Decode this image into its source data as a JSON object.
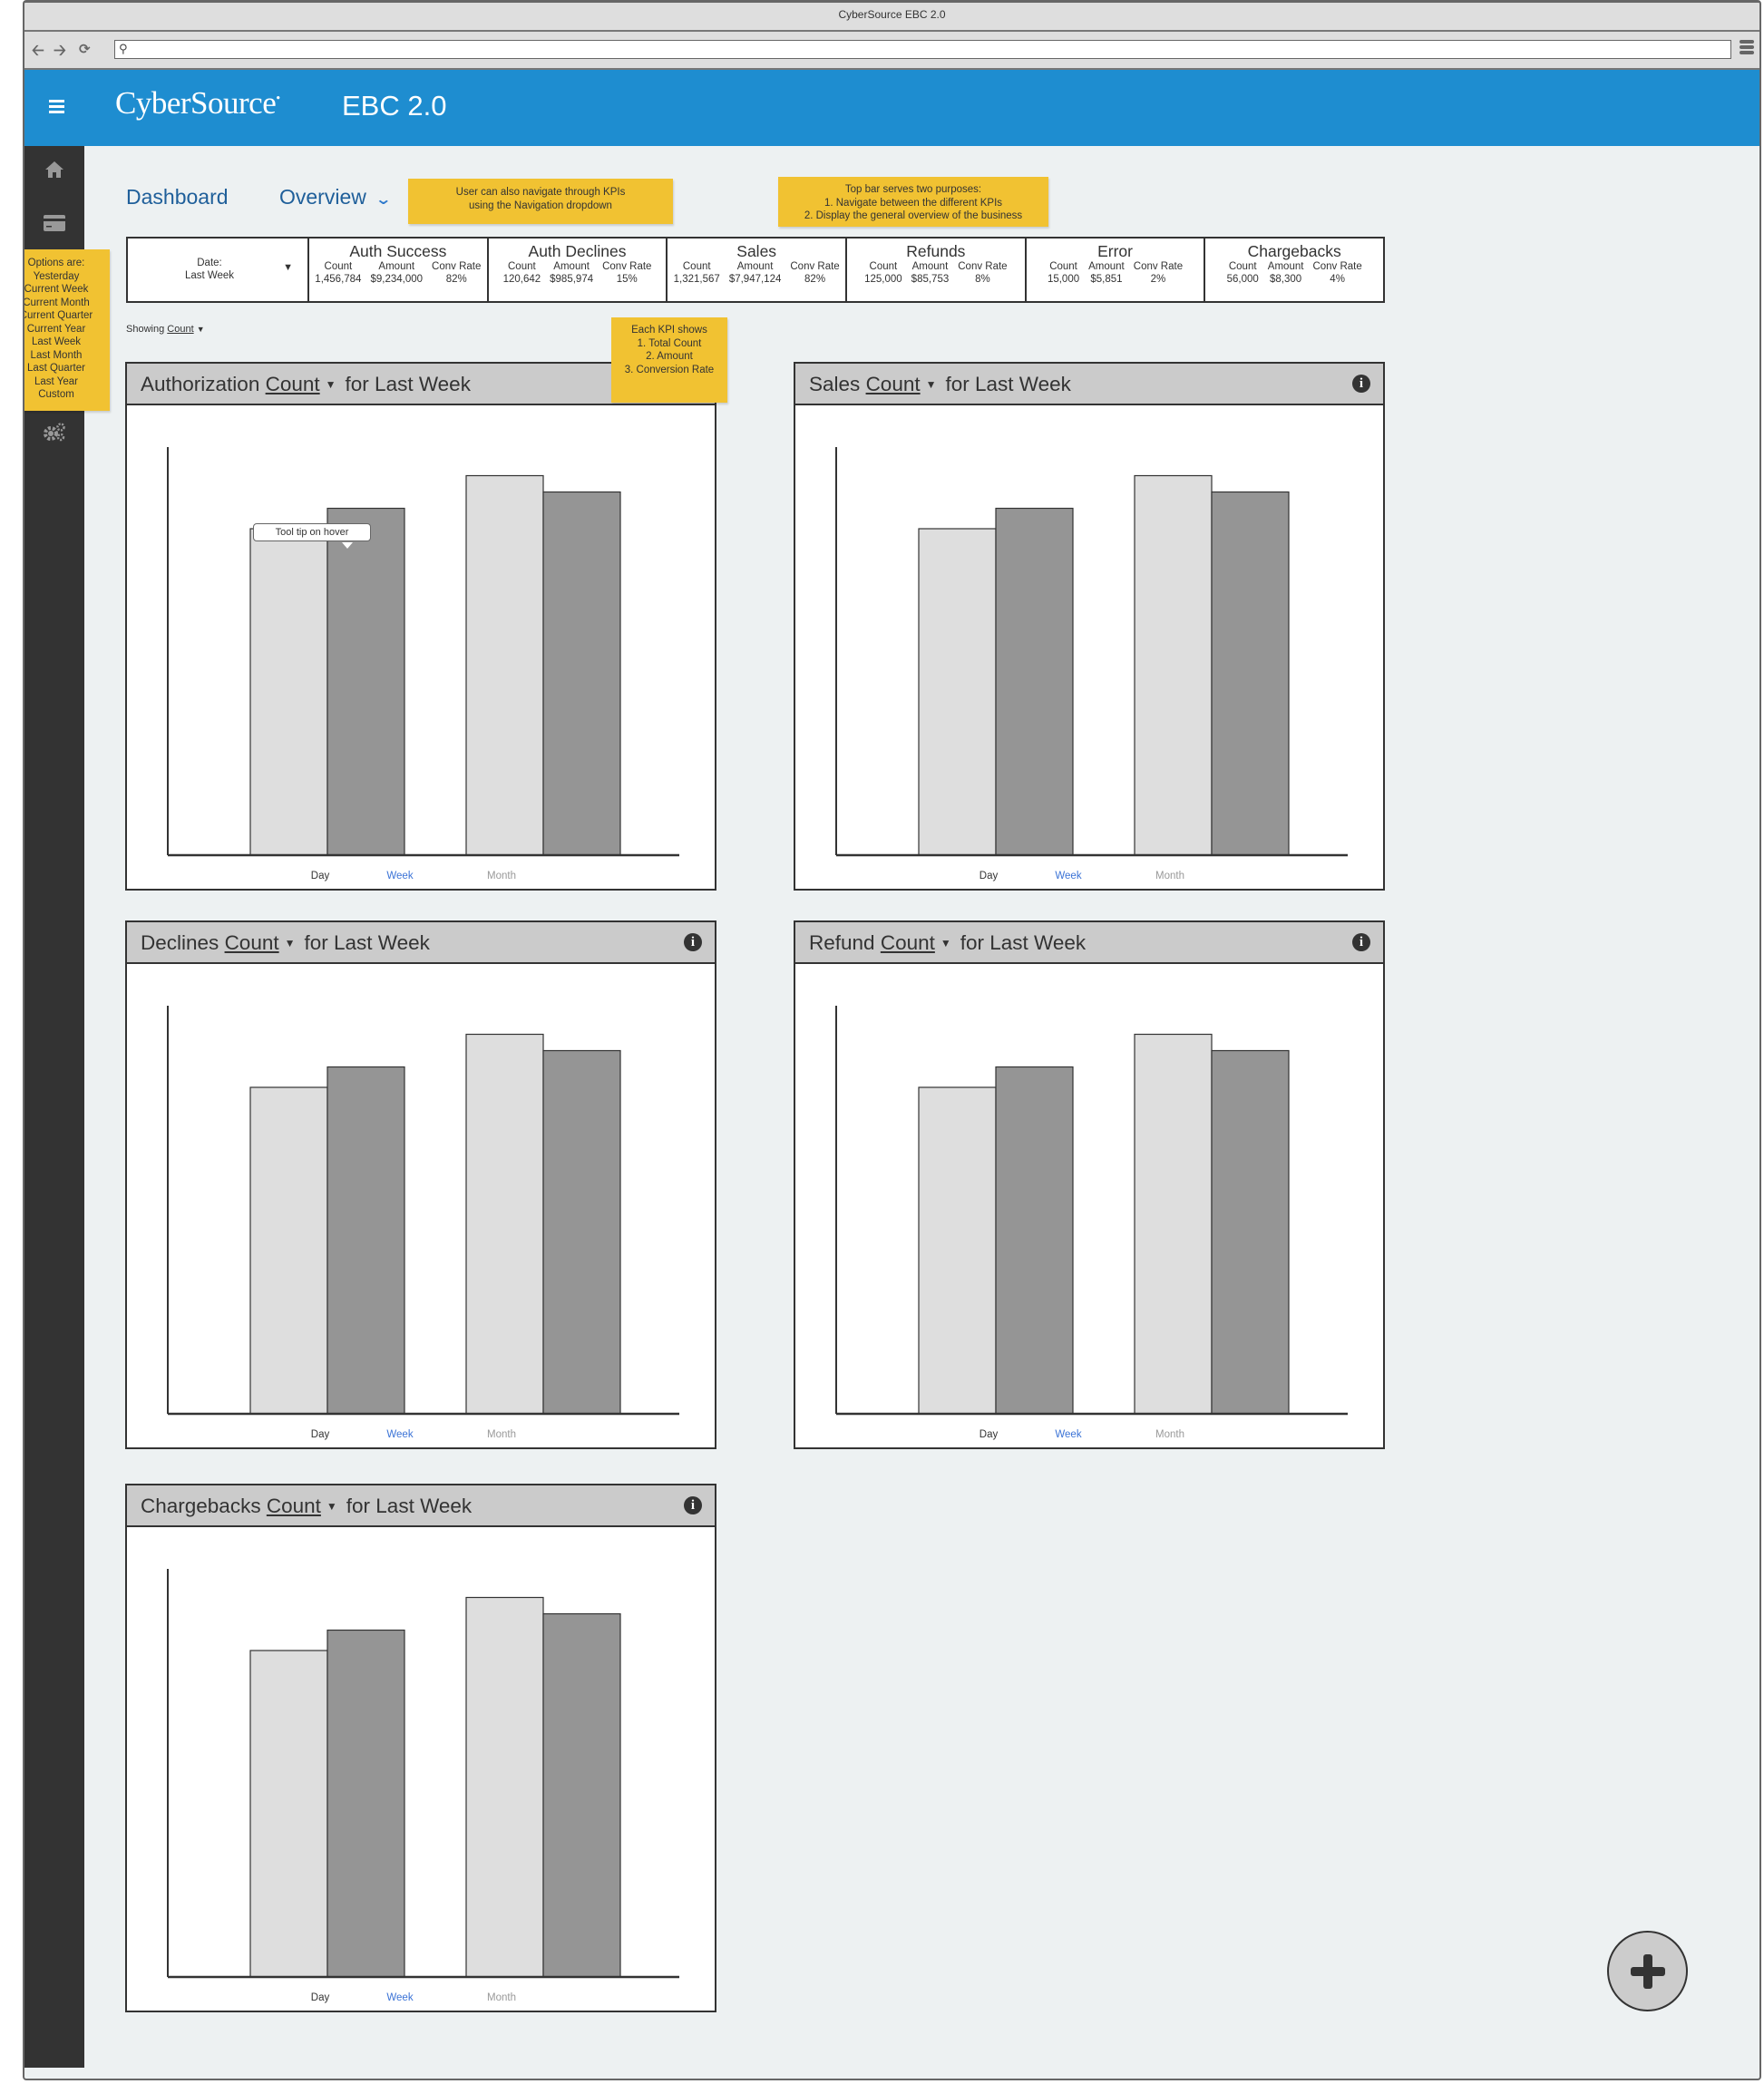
{
  "browser": {
    "window_title": "CyberSource EBC 2.0",
    "url_value": "",
    "icons": [
      "back-arrow-icon",
      "forward-arrow-icon",
      "reload-icon",
      "search-icon",
      "browser-menu-icon"
    ]
  },
  "header": {
    "brand": "CyberSource",
    "brand_mark": "•",
    "app_name": "EBC 2.0",
    "menu_icon": "hamburger-icon",
    "accent_color": "#1e8dd0"
  },
  "sidebar": {
    "items": [
      {
        "name": "home",
        "icon": "home-icon"
      },
      {
        "name": "payments",
        "icon": "credit-card-icon"
      },
      {
        "name": "settings",
        "icon": "gears-icon"
      }
    ]
  },
  "breadcrumb": {
    "dashboard": "Dashboard",
    "overview": "Overview"
  },
  "annotations": {
    "nav_dropdown": "User can also navigate through KPIs using the Navigation dropdown",
    "top_bar_title": "Top bar serves two purposes:",
    "top_bar_1": "1. Navigate between the different KPIs",
    "top_bar_2": "2. Display the general overview of the business",
    "kpi_shows_title": "Each KPI shows",
    "kpi_shows_1": "1. Total Count",
    "kpi_shows_2": "2. Amount",
    "kpi_shows_3": "3. Conversion Rate",
    "options_title": "Options are:",
    "options": [
      "Yesterday",
      "Current Week",
      "Current Month",
      "Current Quarter",
      "Current Year",
      "Last Week",
      "Last Month",
      "Last Quarter",
      "Last Year",
      "Custom"
    ],
    "tooltip": "Tool tip on hover"
  },
  "kpi_bar": {
    "date_label": "Date:",
    "date_value": "Last Week",
    "col_labels": {
      "count": "Count",
      "amount": "Amount",
      "rate": "Conv Rate"
    },
    "kpis": [
      {
        "title": "Auth Success",
        "count": "1,456,784",
        "amount": "$9,234,000",
        "rate": "82%"
      },
      {
        "title": "Auth Declines",
        "count": "120,642",
        "amount": "$985,974",
        "rate": "15%"
      },
      {
        "title": "Sales",
        "count": "1,321,567",
        "amount": "$7,947,124",
        "rate": "82%"
      },
      {
        "title": "Refunds",
        "count": "125,000",
        "amount": "$85,753",
        "rate": "8%"
      },
      {
        "title": "Error",
        "count": "15,000",
        "amount": "$5,851",
        "rate": "2%"
      },
      {
        "title": "Chargebacks",
        "count": "56,000",
        "amount": "$8,300",
        "rate": "4%"
      }
    ]
  },
  "showing": {
    "label": "Showing",
    "value": "Count"
  },
  "panels": [
    {
      "name": "Authorization",
      "metric": "Count",
      "suffix": "for Last Week",
      "info": false,
      "tooltip": true
    },
    {
      "name": "Sales",
      "metric": "Count",
      "suffix": "for Last Week",
      "info": true,
      "tooltip": false
    },
    {
      "name": "Declines",
      "metric": "Count",
      "suffix": "for Last Week",
      "info": true,
      "tooltip": false
    },
    {
      "name": "Refund",
      "metric": "Count",
      "suffix": "for Last Week",
      "info": true,
      "tooltip": false
    },
    {
      "name": "Chargebacks",
      "metric": "Count",
      "suffix": "for Last Week",
      "info": true,
      "tooltip": false
    }
  ],
  "chart_data": [
    {
      "type": "bar",
      "title": "Authorization Count for Last Week",
      "x_labels": [
        "Day",
        "Week",
        "Month"
      ],
      "x_label_colors": [
        "#333333",
        "#3b73d6",
        "#999999"
      ],
      "ylim": [
        0,
        100
      ],
      "bars": [
        80,
        85,
        93,
        89
      ],
      "bar_colors": [
        "#dedede",
        "#959595",
        "#dedede",
        "#959595"
      ],
      "grid": false
    },
    {
      "type": "bar",
      "title": "Sales Count for Last Week",
      "x_labels": [
        "Day",
        "Week",
        "Month"
      ],
      "x_label_colors": [
        "#333333",
        "#3b73d6",
        "#999999"
      ],
      "ylim": [
        0,
        100
      ],
      "bars": [
        80,
        85,
        93,
        89
      ],
      "bar_colors": [
        "#dedede",
        "#959595",
        "#dedede",
        "#959595"
      ],
      "grid": false
    },
    {
      "type": "bar",
      "title": "Declines Count for Last Week",
      "x_labels": [
        "Day",
        "Week",
        "Month"
      ],
      "x_label_colors": [
        "#333333",
        "#3b73d6",
        "#999999"
      ],
      "ylim": [
        0,
        100
      ],
      "bars": [
        80,
        85,
        93,
        89
      ],
      "bar_colors": [
        "#dedede",
        "#959595",
        "#dedede",
        "#959595"
      ],
      "grid": false
    },
    {
      "type": "bar",
      "title": "Refund Count for Last Week",
      "x_labels": [
        "Day",
        "Week",
        "Month"
      ],
      "x_label_colors": [
        "#333333",
        "#3b73d6",
        "#999999"
      ],
      "ylim": [
        0,
        100
      ],
      "bars": [
        80,
        85,
        93,
        89
      ],
      "bar_colors": [
        "#dedede",
        "#959595",
        "#dedede",
        "#959595"
      ],
      "grid": false
    },
    {
      "type": "bar",
      "title": "Chargebacks Count for Last Week",
      "x_labels": [
        "Day",
        "Week",
        "Month"
      ],
      "x_label_colors": [
        "#333333",
        "#3b73d6",
        "#999999"
      ],
      "ylim": [
        0,
        100
      ],
      "bars": [
        80,
        85,
        93,
        89
      ],
      "bar_colors": [
        "#dedede",
        "#959595",
        "#dedede",
        "#959595"
      ],
      "grid": false
    }
  ],
  "fab": {
    "icon": "plus-icon"
  }
}
